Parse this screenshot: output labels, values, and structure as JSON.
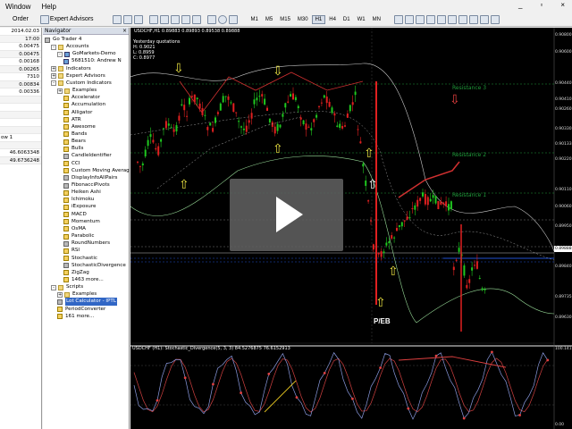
{
  "menu": {
    "items": [
      "Window",
      "Help"
    ]
  },
  "window_controls": {
    "minimize": "_",
    "restore": "▫",
    "close": "×"
  },
  "toolbar": {
    "new_order": "Order",
    "expert_advisors": "Expert Advisors",
    "timeframes": [
      "M1",
      "M5",
      "M15",
      "M30",
      "H1",
      "H4",
      "D1",
      "W1",
      "MN"
    ],
    "selected_timeframe": "H1"
  },
  "left_panel": {
    "rows": [
      "2014.02.03",
      "17:00",
      "0.00475",
      "0.00475",
      "0.00168",
      "0.00265",
      "7310",
      "0.00834",
      "0.00336",
      "",
      "",
      "",
      "",
      "",
      "ow 1",
      "",
      "46.6063348",
      "49.6736248"
    ]
  },
  "navigator": {
    "title": "Navigator",
    "close_label": "×",
    "items": [
      {
        "label": "Go Trader 4",
        "depth": 0,
        "icon": "gray",
        "exp": ""
      },
      {
        "label": "Accounts",
        "depth": 1,
        "icon": "fold",
        "exp": "-"
      },
      {
        "label": "GoMarkets-Demo",
        "depth": 2,
        "icon": "acct",
        "exp": "-"
      },
      {
        "label": "5681510: Andrew N",
        "depth": 3,
        "icon": "acct",
        "exp": ""
      },
      {
        "label": "Indicators",
        "depth": 1,
        "icon": "fold",
        "exp": "+"
      },
      {
        "label": "Expert Advisors",
        "depth": 1,
        "icon": "fold",
        "exp": "+"
      },
      {
        "label": "Custom Indicators",
        "depth": 1,
        "icon": "fold",
        "exp": "-"
      },
      {
        "label": "Examples",
        "depth": 2,
        "icon": "fold",
        "exp": "+"
      },
      {
        "label": "Accelerator",
        "depth": 3,
        "icon": "ind",
        "exp": ""
      },
      {
        "label": "Accumulation",
        "depth": 3,
        "icon": "ind",
        "exp": ""
      },
      {
        "label": "Alligator",
        "depth": 3,
        "icon": "ind",
        "exp": ""
      },
      {
        "label": "ATR",
        "depth": 3,
        "icon": "ind",
        "exp": ""
      },
      {
        "label": "Awesome",
        "depth": 3,
        "icon": "ind",
        "exp": ""
      },
      {
        "label": "Bands",
        "depth": 3,
        "icon": "ind",
        "exp": ""
      },
      {
        "label": "Bears",
        "depth": 3,
        "icon": "ind",
        "exp": ""
      },
      {
        "label": "Bulls",
        "depth": 3,
        "icon": "ind",
        "exp": ""
      },
      {
        "label": "CandleIdentifier",
        "depth": 3,
        "icon": "gray",
        "exp": ""
      },
      {
        "label": "CCI",
        "depth": 3,
        "icon": "ind",
        "exp": ""
      },
      {
        "label": "Custom Moving Averag",
        "depth": 3,
        "icon": "ind",
        "exp": ""
      },
      {
        "label": "DisplayInfoAllPairs",
        "depth": 3,
        "icon": "gray",
        "exp": ""
      },
      {
        "label": "FibonacciPivots",
        "depth": 3,
        "icon": "gray",
        "exp": ""
      },
      {
        "label": "Heiken Ashi",
        "depth": 3,
        "icon": "ind",
        "exp": ""
      },
      {
        "label": "Ichimoku",
        "depth": 3,
        "icon": "ind",
        "exp": ""
      },
      {
        "label": "iExposure",
        "depth": 3,
        "icon": "ind",
        "exp": ""
      },
      {
        "label": "MACD",
        "depth": 3,
        "icon": "ind",
        "exp": ""
      },
      {
        "label": "Momentum",
        "depth": 3,
        "icon": "ind",
        "exp": ""
      },
      {
        "label": "OsMA",
        "depth": 3,
        "icon": "ind",
        "exp": ""
      },
      {
        "label": "Parabolic",
        "depth": 3,
        "icon": "ind",
        "exp": ""
      },
      {
        "label": "RoundNumbers",
        "depth": 3,
        "icon": "gray",
        "exp": ""
      },
      {
        "label": "RSI",
        "depth": 3,
        "icon": "ind",
        "exp": ""
      },
      {
        "label": "Stochastic",
        "depth": 3,
        "icon": "ind",
        "exp": ""
      },
      {
        "label": "StochasticDivergence",
        "depth": 3,
        "icon": "gray",
        "exp": ""
      },
      {
        "label": "ZigZag",
        "depth": 3,
        "icon": "ind",
        "exp": ""
      },
      {
        "label": "1463 more...",
        "depth": 3,
        "icon": "ind",
        "exp": ""
      },
      {
        "label": "Scripts",
        "depth": 1,
        "icon": "fold",
        "exp": "-"
      },
      {
        "label": "Examples",
        "depth": 2,
        "icon": "fold",
        "exp": "+"
      },
      {
        "label": "Lot Calculator - IPTL",
        "depth": 2,
        "icon": "gray",
        "exp": "",
        "selected": true
      },
      {
        "label": "PeriodConverter",
        "depth": 2,
        "icon": "ind",
        "exp": ""
      },
      {
        "label": "161 more...",
        "depth": 2,
        "icon": "ind",
        "exp": ""
      }
    ]
  },
  "chart": {
    "header": "USDCHF,H1  0.89883 0.89893 0.89538 0.89888",
    "info_lines": [
      "Yesterday quotations",
      "H: 0.9021",
      "L: 0.8959",
      "C: 0.8977"
    ],
    "resistance_labels": [
      "Resistance 3",
      "Resistance 2",
      "Resistance 1"
    ],
    "marker_label": "P/EB",
    "price_scale": [
      "0.90800",
      "0.90600",
      "0.90440",
      "0.90410",
      "0.90260",
      "0.90330",
      "0.90133",
      "0.90220",
      "0.90110",
      "0.90060",
      "0.89950",
      "0.89888",
      "0.89840",
      "0.89735",
      "0.89630"
    ],
    "sub_header": "USDCHF (H1):  Stochastic_Divergence(5, 3, 3) 84.5276875 76.6152913",
    "sub_scale": [
      "100.14135",
      "0.00"
    ],
    "colors": {
      "background": "#000000",
      "bull": "#1fc81f",
      "bear": "#e02020",
      "resistance": "#1f9a3a"
    }
  }
}
